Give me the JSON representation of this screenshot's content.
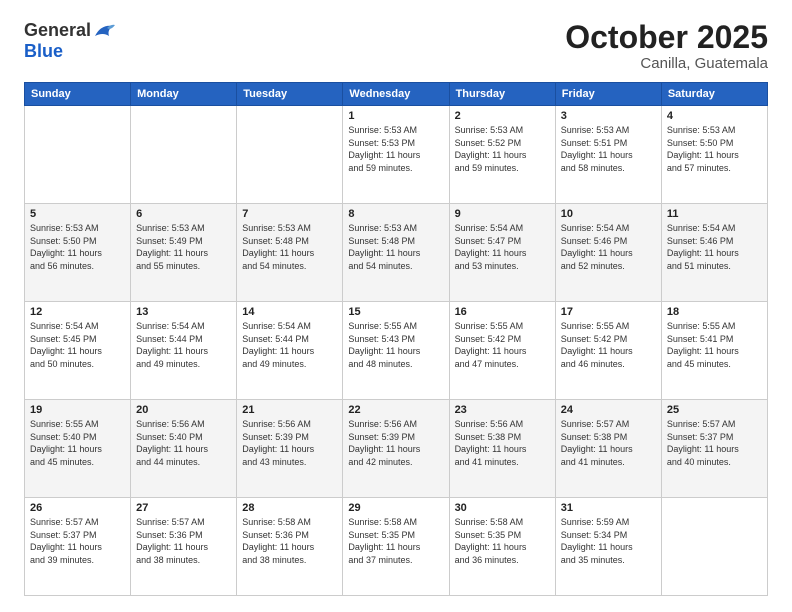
{
  "header": {
    "logo_general": "General",
    "logo_blue": "Blue",
    "month": "October 2025",
    "location": "Canilla, Guatemala"
  },
  "days_of_week": [
    "Sunday",
    "Monday",
    "Tuesday",
    "Wednesday",
    "Thursday",
    "Friday",
    "Saturday"
  ],
  "weeks": [
    [
      {
        "day": "",
        "info": ""
      },
      {
        "day": "",
        "info": ""
      },
      {
        "day": "",
        "info": ""
      },
      {
        "day": "1",
        "info": "Sunrise: 5:53 AM\nSunset: 5:53 PM\nDaylight: 11 hours\nand 59 minutes."
      },
      {
        "day": "2",
        "info": "Sunrise: 5:53 AM\nSunset: 5:52 PM\nDaylight: 11 hours\nand 59 minutes."
      },
      {
        "day": "3",
        "info": "Sunrise: 5:53 AM\nSunset: 5:51 PM\nDaylight: 11 hours\nand 58 minutes."
      },
      {
        "day": "4",
        "info": "Sunrise: 5:53 AM\nSunset: 5:50 PM\nDaylight: 11 hours\nand 57 minutes."
      }
    ],
    [
      {
        "day": "5",
        "info": "Sunrise: 5:53 AM\nSunset: 5:50 PM\nDaylight: 11 hours\nand 56 minutes."
      },
      {
        "day": "6",
        "info": "Sunrise: 5:53 AM\nSunset: 5:49 PM\nDaylight: 11 hours\nand 55 minutes."
      },
      {
        "day": "7",
        "info": "Sunrise: 5:53 AM\nSunset: 5:48 PM\nDaylight: 11 hours\nand 54 minutes."
      },
      {
        "day": "8",
        "info": "Sunrise: 5:53 AM\nSunset: 5:48 PM\nDaylight: 11 hours\nand 54 minutes."
      },
      {
        "day": "9",
        "info": "Sunrise: 5:54 AM\nSunset: 5:47 PM\nDaylight: 11 hours\nand 53 minutes."
      },
      {
        "day": "10",
        "info": "Sunrise: 5:54 AM\nSunset: 5:46 PM\nDaylight: 11 hours\nand 52 minutes."
      },
      {
        "day": "11",
        "info": "Sunrise: 5:54 AM\nSunset: 5:46 PM\nDaylight: 11 hours\nand 51 minutes."
      }
    ],
    [
      {
        "day": "12",
        "info": "Sunrise: 5:54 AM\nSunset: 5:45 PM\nDaylight: 11 hours\nand 50 minutes."
      },
      {
        "day": "13",
        "info": "Sunrise: 5:54 AM\nSunset: 5:44 PM\nDaylight: 11 hours\nand 49 minutes."
      },
      {
        "day": "14",
        "info": "Sunrise: 5:54 AM\nSunset: 5:44 PM\nDaylight: 11 hours\nand 49 minutes."
      },
      {
        "day": "15",
        "info": "Sunrise: 5:55 AM\nSunset: 5:43 PM\nDaylight: 11 hours\nand 48 minutes."
      },
      {
        "day": "16",
        "info": "Sunrise: 5:55 AM\nSunset: 5:42 PM\nDaylight: 11 hours\nand 47 minutes."
      },
      {
        "day": "17",
        "info": "Sunrise: 5:55 AM\nSunset: 5:42 PM\nDaylight: 11 hours\nand 46 minutes."
      },
      {
        "day": "18",
        "info": "Sunrise: 5:55 AM\nSunset: 5:41 PM\nDaylight: 11 hours\nand 45 minutes."
      }
    ],
    [
      {
        "day": "19",
        "info": "Sunrise: 5:55 AM\nSunset: 5:40 PM\nDaylight: 11 hours\nand 45 minutes."
      },
      {
        "day": "20",
        "info": "Sunrise: 5:56 AM\nSunset: 5:40 PM\nDaylight: 11 hours\nand 44 minutes."
      },
      {
        "day": "21",
        "info": "Sunrise: 5:56 AM\nSunset: 5:39 PM\nDaylight: 11 hours\nand 43 minutes."
      },
      {
        "day": "22",
        "info": "Sunrise: 5:56 AM\nSunset: 5:39 PM\nDaylight: 11 hours\nand 42 minutes."
      },
      {
        "day": "23",
        "info": "Sunrise: 5:56 AM\nSunset: 5:38 PM\nDaylight: 11 hours\nand 41 minutes."
      },
      {
        "day": "24",
        "info": "Sunrise: 5:57 AM\nSunset: 5:38 PM\nDaylight: 11 hours\nand 41 minutes."
      },
      {
        "day": "25",
        "info": "Sunrise: 5:57 AM\nSunset: 5:37 PM\nDaylight: 11 hours\nand 40 minutes."
      }
    ],
    [
      {
        "day": "26",
        "info": "Sunrise: 5:57 AM\nSunset: 5:37 PM\nDaylight: 11 hours\nand 39 minutes."
      },
      {
        "day": "27",
        "info": "Sunrise: 5:57 AM\nSunset: 5:36 PM\nDaylight: 11 hours\nand 38 minutes."
      },
      {
        "day": "28",
        "info": "Sunrise: 5:58 AM\nSunset: 5:36 PM\nDaylight: 11 hours\nand 38 minutes."
      },
      {
        "day": "29",
        "info": "Sunrise: 5:58 AM\nSunset: 5:35 PM\nDaylight: 11 hours\nand 37 minutes."
      },
      {
        "day": "30",
        "info": "Sunrise: 5:58 AM\nSunset: 5:35 PM\nDaylight: 11 hours\nand 36 minutes."
      },
      {
        "day": "31",
        "info": "Sunrise: 5:59 AM\nSunset: 5:34 PM\nDaylight: 11 hours\nand 35 minutes."
      },
      {
        "day": "",
        "info": ""
      }
    ]
  ]
}
